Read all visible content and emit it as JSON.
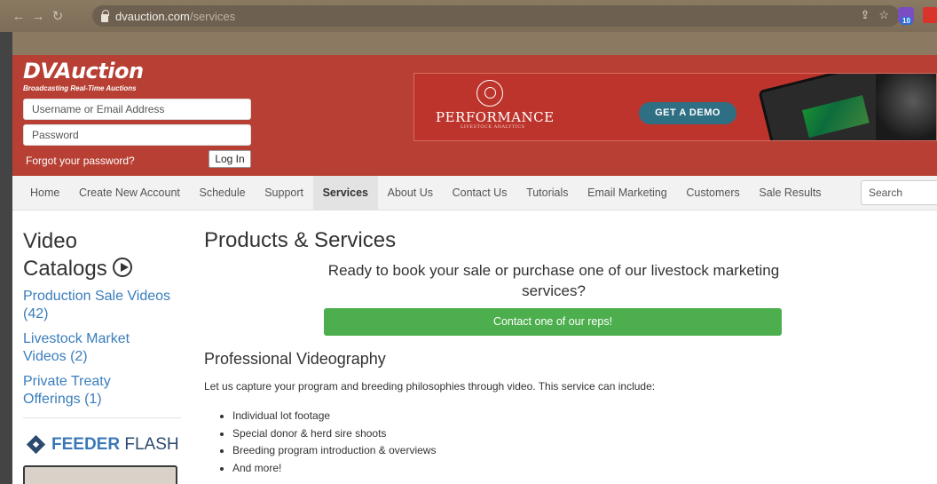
{
  "browser": {
    "url_domain": "dvauction.com",
    "url_path": "/services",
    "ext_badge": "10"
  },
  "header": {
    "logo": "DVAuction",
    "tagline": "Broadcasting Real-Time Auctions",
    "username_placeholder": "Username or Email Address",
    "password_placeholder": "Password",
    "forgot_label": "Forgot your password?",
    "login_label": "Log In"
  },
  "ad": {
    "brand": "PERFORMANCE",
    "sub": "LIVESTOCK ANALYTICS",
    "cta": "GET A DEMO"
  },
  "nav": {
    "items": [
      "Home",
      "Create New Account",
      "Schedule",
      "Support",
      "Services",
      "About Us",
      "Contact Us",
      "Tutorials",
      "Email Marketing",
      "Customers",
      "Sale Results"
    ],
    "active": "Services",
    "search_placeholder": "Search"
  },
  "sidebar": {
    "title_line1": "Video",
    "title_line2": "Catalogs",
    "links": [
      {
        "line1": "Production Sale Videos",
        "line2": "(42)"
      },
      {
        "line1": "Livestock Market",
        "line2": "Videos (2)"
      },
      {
        "line1": "Private Treaty",
        "line2": "Offerings (1)"
      }
    ],
    "feeder_bold": "FEEDER",
    "feeder_light": " FLASH"
  },
  "main": {
    "title": "Products & Services",
    "lead": "Ready to book your sale or purchase one of our livestock marketing services?",
    "cta": "Contact one of our reps!",
    "section_title": "Professional Videography",
    "section_para": "Let us capture your program and breeding philosophies through video. This service can include:",
    "bullets": [
      "Individual lot footage",
      "Special donor & herd sire shoots",
      "Breeding program introduction & overviews",
      "And more!"
    ]
  }
}
